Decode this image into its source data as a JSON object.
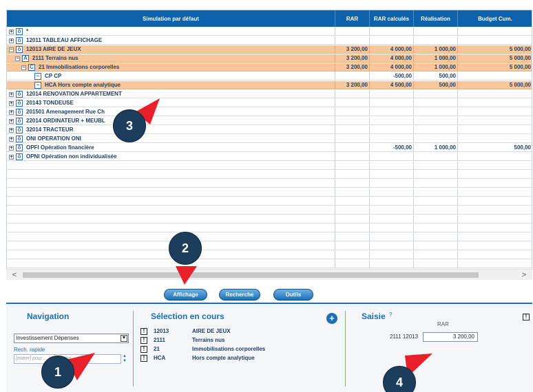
{
  "grid": {
    "headers": [
      "Simulation par défaut",
      "RAR",
      "RAR calculés",
      "Réalisation",
      "Budget Cum."
    ],
    "rows": [
      {
        "toggle": "+",
        "icon": "ō",
        "label": "*",
        "rar": "",
        "rar_calc": "",
        "real": "",
        "budget": "",
        "sel": false,
        "indent": 0
      },
      {
        "toggle": "+",
        "icon": "ō",
        "label": "12011 TABLEAU AFFICHAGE",
        "rar": "",
        "rar_calc": "",
        "real": "",
        "budget": "",
        "sel": false,
        "indent": 0
      },
      {
        "toggle": "−",
        "icon": "ō",
        "label": "12013 AIRE DE JEUX",
        "rar": "3 200,00",
        "rar_calc": "4 000,00",
        "real": "1 000,00",
        "budget": "5 000,00",
        "sel": true,
        "indent": 0
      },
      {
        "toggle": "−",
        "icon": "A",
        "label": "2111 Terrains nus",
        "rar": "3 200,00",
        "rar_calc": "4 000,00",
        "real": "1 000,00",
        "budget": "5 000,00",
        "sel": true,
        "indent": 1
      },
      {
        "toggle": "−",
        "icon": "C",
        "label": "21 Immobilisations corporelles",
        "rar": "3 200,00",
        "rar_calc": "4 000,00",
        "real": "1 000,00",
        "budget": "5 000,00",
        "sel": true,
        "indent": 2
      },
      {
        "toggle": "",
        "icon": "~",
        "label": "CP CP",
        "rar": "",
        "rar_calc": "-500,00",
        "real": "500,00",
        "budget": "",
        "sel": false,
        "indent": 3
      },
      {
        "toggle": "",
        "icon": "~",
        "label": "HCA Hors compte analytique",
        "rar": "3 200,00",
        "rar_calc": "4 500,00",
        "real": "500,00",
        "budget": "5 000,00",
        "sel": true,
        "indent": 3
      },
      {
        "toggle": "+",
        "icon": "ō",
        "label": "12014 RENOVATION APPARTEMENT",
        "rar": "",
        "rar_calc": "",
        "real": "",
        "budget": "",
        "sel": false,
        "indent": 0
      },
      {
        "toggle": "+",
        "icon": "ō",
        "label": "20143 TONDEUSE",
        "rar": "",
        "rar_calc": "",
        "real": "",
        "budget": "",
        "sel": false,
        "indent": 0
      },
      {
        "toggle": "+",
        "icon": "ō",
        "label": "201501 Amenagement Rue Ch",
        "rar": "",
        "rar_calc": "",
        "real": "",
        "budget": "",
        "sel": false,
        "indent": 0
      },
      {
        "toggle": "+",
        "icon": "ō",
        "label": "22014 ORDINATEUR + MEUBL",
        "rar": "",
        "rar_calc": "",
        "real": "",
        "budget": "",
        "sel": false,
        "indent": 0
      },
      {
        "toggle": "+",
        "icon": "ō",
        "label": "32014 TRACTEUR",
        "rar": "",
        "rar_calc": "",
        "real": "",
        "budget": "",
        "sel": false,
        "indent": 0
      },
      {
        "toggle": "+",
        "icon": "ō",
        "label": "ONI OPERATION ONI",
        "rar": "",
        "rar_calc": "",
        "real": "",
        "budget": "",
        "sel": false,
        "indent": 0
      },
      {
        "toggle": "+",
        "icon": "ō",
        "label": "OPFI Opération financière",
        "rar": "",
        "rar_calc": "-500,00",
        "real": "1 000,00",
        "budget": "500,00",
        "sel": false,
        "indent": 0
      },
      {
        "toggle": "+",
        "icon": "ō",
        "label": "OPNI Opération non individualisée",
        "rar": "",
        "rar_calc": "",
        "real": "",
        "budget": "",
        "sel": false,
        "indent": 0
      }
    ]
  },
  "toolbar": {
    "affichage": "Affichage",
    "recherche": "Recherche",
    "outils": "Outils"
  },
  "navigation": {
    "title": "Navigation",
    "selected": "Investissement Dépenses",
    "rech_label": "Rech. rapide",
    "rech_placeholder": "[entrer] pour ... la ... erche"
  },
  "selection": {
    "title": "Sélection en cours",
    "items": [
      {
        "code": "12013",
        "desc": "AIRE DE JEUX"
      },
      {
        "code": "2111",
        "desc": "Terrains nus"
      },
      {
        "code": "21",
        "desc": "Immobilisations corporelles"
      },
      {
        "code": "HCA",
        "desc": "Hors compte analytique"
      }
    ]
  },
  "saisie": {
    "title": "Saisie",
    "help": "?",
    "col": "RAR",
    "code": "2111 12013",
    "value": "3 200,00"
  },
  "callouts": [
    "1",
    "2",
    "3",
    "4"
  ],
  "colors": {
    "header": "#0e61ab",
    "selected_row": "#f9c79c",
    "callout": "#1c3d5c",
    "pointer": "#e8202a"
  }
}
